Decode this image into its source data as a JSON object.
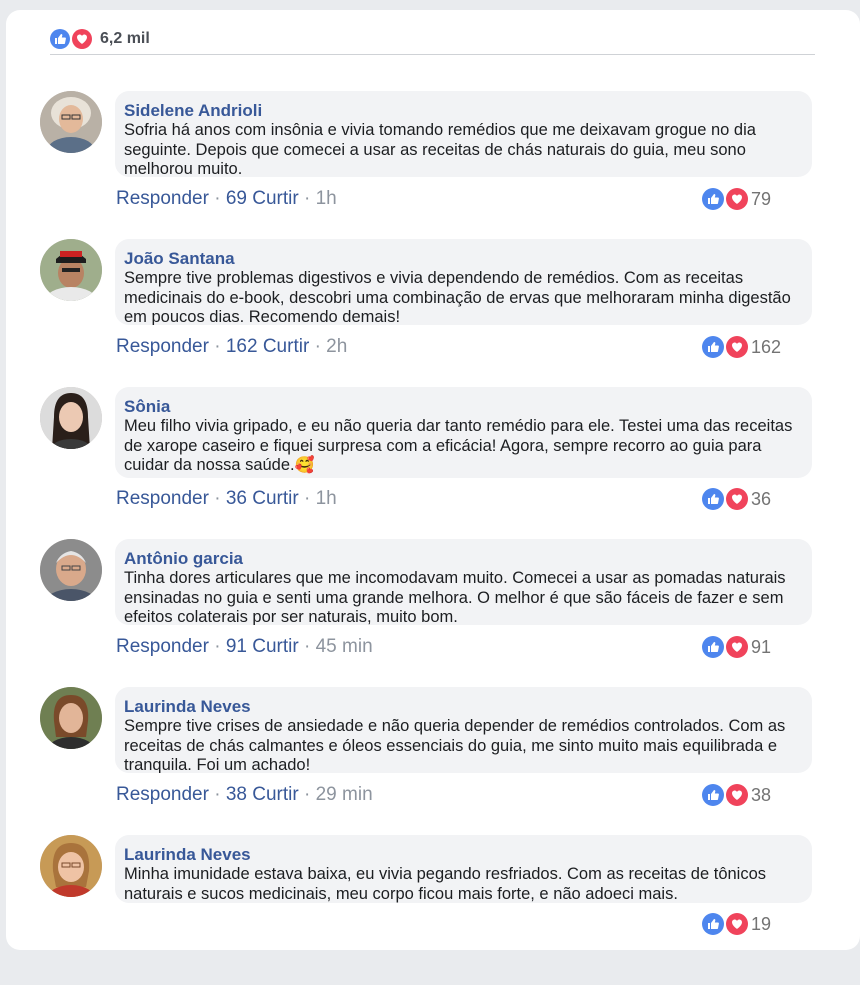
{
  "header": {
    "reaction_count": "6,2 mil",
    "like_icon": "thumbs-up-icon",
    "love_icon": "heart-icon"
  },
  "labels": {
    "reply": "Responder",
    "like_suffix": "Curtir",
    "sep": "·"
  },
  "comments": [
    {
      "author": "Sidelene Andrioli",
      "text": "Sofria há anos com insônia e vivia tomando remédios que me deixavam grogue no dia seguinte. Depois que comecei a usar as receitas de chás naturais do guia, meu sono melhorou muito.",
      "likes": "69",
      "time": "1h",
      "reactions": "79"
    },
    {
      "author": "João Santana",
      "text": "Sempre tive problemas digestivos e vivia dependendo de remédios. Com as receitas medicinais do e-book, descobri uma combinação de ervas que melhoraram minha digestão em poucos dias. Recomendo demais!",
      "likes": "162",
      "time": "2h",
      "reactions": "162"
    },
    {
      "author": "Sônia",
      "text": "Meu filho vivia gripado, e eu não queria dar tanto remédio para ele. Testei uma das receitas de xarope caseiro e fiquei surpresa com a eficácia! Agora, sempre recorro ao guia para cuidar da nossa saúde.",
      "emoji": "🥰",
      "likes": "36",
      "time": "1h",
      "reactions": "36"
    },
    {
      "author": "Antônio garcia",
      "text": "Tinha dores articulares que me incomodavam muito. Comecei a usar as pomadas naturais ensinadas no guia e senti uma grande melhora. O melhor é que são fáceis de fazer e sem efeitos colaterais por ser naturais, muito bom.",
      "likes": "91",
      "time": "45 min",
      "reactions": "91"
    },
    {
      "author": "Laurinda Neves",
      "text": "Sempre tive crises de ansiedade e não queria depender de remédios controlados. Com as receitas de chás calmantes e óleos essenciais do guia, me sinto muito mais equilibrada e tranquila. Foi um achado!",
      "likes": "38",
      "time": "29 min",
      "reactions": "38"
    },
    {
      "author": "Laurinda Neves",
      "text": "Minha imunidade estava baixa, eu vivia pegando resfriados. Com as receitas de tônicos naturais e sucos medicinais, meu corpo ficou mais forte, e não adoeci mais.",
      "reactions": "19"
    }
  ]
}
